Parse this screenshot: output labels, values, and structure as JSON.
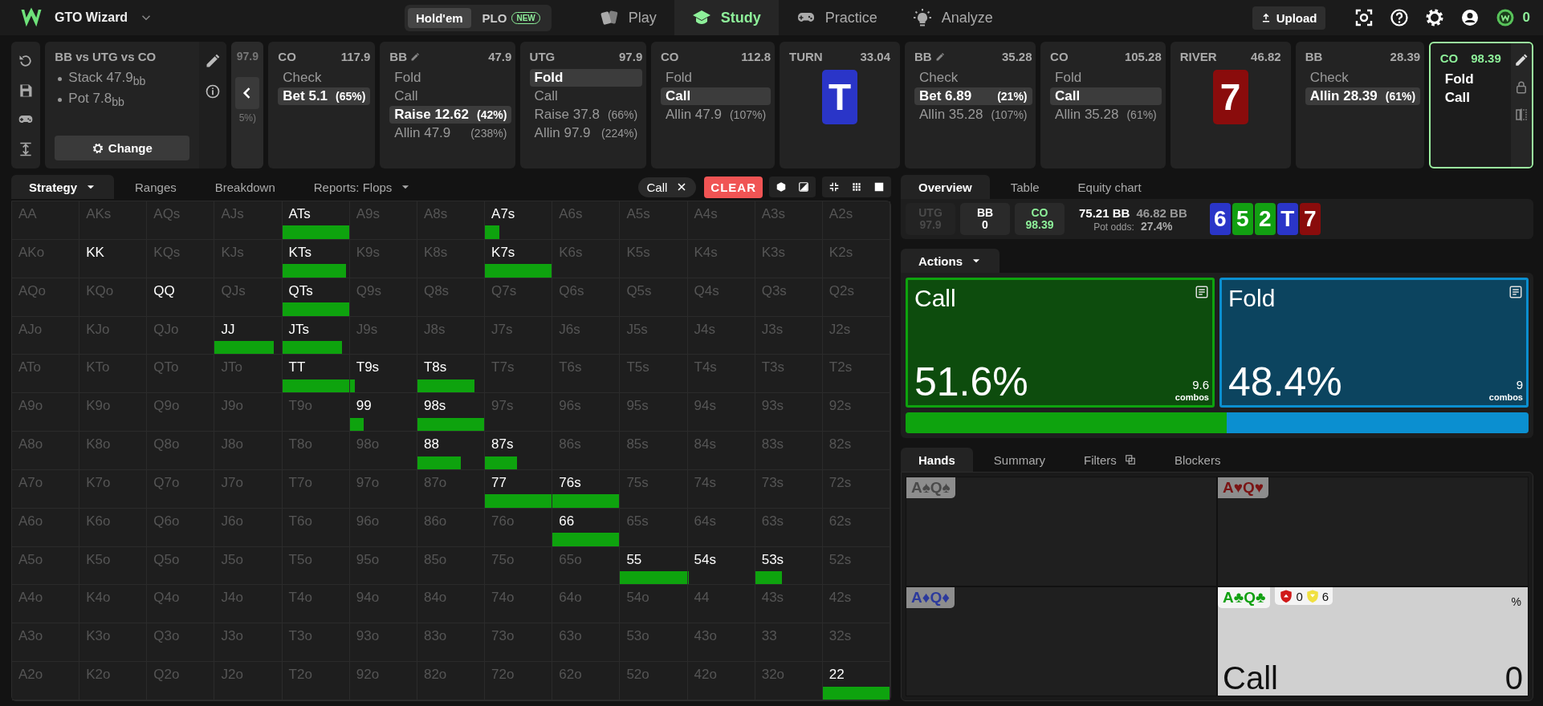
{
  "nav": {
    "brand": "GTO Wizard",
    "games": [
      {
        "label": "Hold'em",
        "selected": true
      },
      {
        "label": "PLO",
        "selected": false,
        "badge": "NEW"
      }
    ],
    "links": [
      {
        "label": "Play",
        "selected": false
      },
      {
        "label": "Study",
        "selected": true
      },
      {
        "label": "Practice",
        "selected": false
      },
      {
        "label": "Analyze",
        "selected": false
      }
    ],
    "upload": "Upload",
    "coins": "0"
  },
  "spot": {
    "title": "BB vs UTG vs CO",
    "stats": [
      "Stack 47.9$_{bb}$",
      "Pot 7.8$_{bb}$"
    ],
    "button": "Change"
  },
  "partial": {
    "stack": "97.9",
    "pct": "5%)"
  },
  "cards": [
    {
      "kind": "action",
      "player": "CO",
      "stack": "117.9",
      "edited": false,
      "current": false,
      "options": [
        {
          "label": "Check",
          "selected": false
        },
        {
          "label": "Bet 5.1",
          "pct": "(65%)",
          "selected": true
        }
      ]
    },
    {
      "kind": "action",
      "player": "BB",
      "stack": "47.9",
      "edited": true,
      "current": false,
      "options": [
        {
          "label": "Fold",
          "selected": false
        },
        {
          "label": "Call",
          "selected": false
        },
        {
          "label": "Raise 12.62",
          "pct": "(42%)",
          "selected": true
        },
        {
          "label": "Allin 47.9",
          "pct": "(238%)",
          "selected": false
        }
      ]
    },
    {
      "kind": "action",
      "player": "UTG",
      "stack": "97.9",
      "edited": false,
      "current": false,
      "options": [
        {
          "label": "Fold",
          "selected": true
        },
        {
          "label": "Call",
          "selected": false
        },
        {
          "label": "Raise 37.8",
          "pct": "(66%)",
          "selected": false
        },
        {
          "label": "Allin 97.9",
          "pct": "(224%)",
          "selected": false
        }
      ]
    },
    {
      "kind": "action",
      "player": "CO",
      "stack": "112.8",
      "edited": false,
      "current": false,
      "options": [
        {
          "label": "Fold",
          "selected": false
        },
        {
          "label": "Call",
          "selected": true
        },
        {
          "label": "Allin 47.9",
          "pct": "(107%)",
          "selected": false
        }
      ]
    },
    {
      "kind": "street",
      "street": "TURN",
      "pot": "33.04",
      "card": {
        "rank": "T",
        "color": "#2a35c8"
      }
    },
    {
      "kind": "action",
      "player": "BB",
      "stack": "35.28",
      "edited": true,
      "current": false,
      "options": [
        {
          "label": "Check",
          "selected": false
        },
        {
          "label": "Bet 6.89",
          "pct": "(21%)",
          "selected": true
        },
        {
          "label": "Allin 35.28",
          "pct": "(107%)",
          "selected": false
        }
      ]
    },
    {
      "kind": "action",
      "player": "CO",
      "stack": "105.28",
      "edited": false,
      "current": false,
      "options": [
        {
          "label": "Fold",
          "selected": false
        },
        {
          "label": "Call",
          "selected": true
        },
        {
          "label": "Allin 35.28",
          "pct": "(61%)",
          "selected": false
        }
      ]
    },
    {
      "kind": "street",
      "street": "RIVER",
      "pot": "46.82",
      "card": {
        "rank": "7",
        "color": "#8a0c0c"
      }
    },
    {
      "kind": "action",
      "player": "BB",
      "stack": "28.39",
      "edited": false,
      "current": false,
      "options": [
        {
          "label": "Check",
          "selected": false
        },
        {
          "label": "Allin 28.39",
          "pct": "(61%)",
          "selected": true
        }
      ]
    },
    {
      "kind": "action",
      "player": "CO",
      "stack": "98.39",
      "edited": false,
      "current": true,
      "options": [
        {
          "label": "Fold",
          "selected": false
        },
        {
          "label": "Call",
          "selected": false
        }
      ]
    }
  ],
  "strategy": {
    "tabs": [
      {
        "label": "Strategy",
        "selected": true,
        "dropdown": true
      },
      {
        "label": "Ranges",
        "selected": false,
        "dropdown": false
      },
      {
        "label": "Breakdown",
        "selected": false,
        "dropdown": false
      },
      {
        "label": "Reports: Flops",
        "selected": false,
        "dropdown": true
      }
    ],
    "filter": "Call",
    "clear": "CLEAR",
    "matrix": [
      [
        {
          "hand": "AA",
          "in_range": false
        },
        {
          "hand": "AKs",
          "in_range": false
        },
        {
          "hand": "AQs",
          "in_range": false
        },
        {
          "hand": "AJs",
          "in_range": false
        },
        {
          "hand": "ATs",
          "in_range": true,
          "call": {
            "level": 1
          }
        },
        {
          "hand": "A9s",
          "in_range": false
        },
        {
          "hand": "A8s",
          "in_range": false
        },
        {
          "hand": "A7s",
          "in_range": true,
          "call": {
            "level": 0.21
          }
        },
        {
          "hand": "A6s",
          "in_range": false
        },
        {
          "hand": "A5s",
          "in_range": false
        },
        {
          "hand": "A4s",
          "in_range": false
        },
        {
          "hand": "A3s",
          "in_range": false
        },
        {
          "hand": "A2s",
          "in_range": false
        }
      ],
      [
        {
          "hand": "AKo",
          "in_range": false
        },
        {
          "hand": "KK",
          "in_range": true
        },
        {
          "hand": "KQs",
          "in_range": false
        },
        {
          "hand": "KJs",
          "in_range": false
        },
        {
          "hand": "KTs",
          "in_range": true,
          "call": {
            "level": 0.95
          }
        },
        {
          "hand": "K9s",
          "in_range": false
        },
        {
          "hand": "K8s",
          "in_range": false
        },
        {
          "hand": "K7s",
          "in_range": true,
          "call": {
            "level": 1
          }
        },
        {
          "hand": "K6s",
          "in_range": false
        },
        {
          "hand": "K5s",
          "in_range": false
        },
        {
          "hand": "K4s",
          "in_range": false
        },
        {
          "hand": "K3s",
          "in_range": false
        },
        {
          "hand": "K2s",
          "in_range": false
        }
      ],
      [
        {
          "hand": "AQo",
          "in_range": false
        },
        {
          "hand": "KQo",
          "in_range": false
        },
        {
          "hand": "QQ",
          "in_range": true
        },
        {
          "hand": "QJs",
          "in_range": false
        },
        {
          "hand": "QTs",
          "in_range": true,
          "call": {
            "level": 1
          }
        },
        {
          "hand": "Q9s",
          "in_range": false
        },
        {
          "hand": "Q8s",
          "in_range": false
        },
        {
          "hand": "Q7s",
          "in_range": false
        },
        {
          "hand": "Q6s",
          "in_range": false
        },
        {
          "hand": "Q5s",
          "in_range": false
        },
        {
          "hand": "Q4s",
          "in_range": false
        },
        {
          "hand": "Q3s",
          "in_range": false
        },
        {
          "hand": "Q2s",
          "in_range": false
        }
      ],
      [
        {
          "hand": "AJo",
          "in_range": false
        },
        {
          "hand": "KJo",
          "in_range": false
        },
        {
          "hand": "QJo",
          "in_range": false
        },
        {
          "hand": "JJ",
          "in_range": true,
          "call": {
            "level": 0.88
          }
        },
        {
          "hand": "JTs",
          "in_range": true,
          "call": {
            "level": 0.9
          }
        },
        {
          "hand": "J9s",
          "in_range": false
        },
        {
          "hand": "J8s",
          "in_range": false
        },
        {
          "hand": "J7s",
          "in_range": false
        },
        {
          "hand": "J6s",
          "in_range": false
        },
        {
          "hand": "J5s",
          "in_range": false
        },
        {
          "hand": "J4s",
          "in_range": false
        },
        {
          "hand": "J3s",
          "in_range": false
        },
        {
          "hand": "J2s",
          "in_range": false
        }
      ],
      [
        {
          "hand": "ATo",
          "in_range": false
        },
        {
          "hand": "KTo",
          "in_range": false
        },
        {
          "hand": "QTo",
          "in_range": false
        },
        {
          "hand": "JTo",
          "in_range": false
        },
        {
          "hand": "TT",
          "in_range": true,
          "call": {
            "level": 1
          }
        },
        {
          "hand": "T9s",
          "in_range": true,
          "call": {
            "level": 0.07
          }
        },
        {
          "hand": "T8s",
          "in_range": true,
          "call": {
            "level": 0.85
          }
        },
        {
          "hand": "T7s",
          "in_range": false
        },
        {
          "hand": "T6s",
          "in_range": false
        },
        {
          "hand": "T5s",
          "in_range": false
        },
        {
          "hand": "T4s",
          "in_range": false
        },
        {
          "hand": "T3s",
          "in_range": false
        },
        {
          "hand": "T2s",
          "in_range": false
        }
      ],
      [
        {
          "hand": "A9o",
          "in_range": false
        },
        {
          "hand": "K9o",
          "in_range": false
        },
        {
          "hand": "Q9o",
          "in_range": false
        },
        {
          "hand": "J9o",
          "in_range": false
        },
        {
          "hand": "T9o",
          "in_range": false
        },
        {
          "hand": "99",
          "in_range": true,
          "call": {
            "level": 0.21
          }
        },
        {
          "hand": "98s",
          "in_range": true,
          "call": {
            "level": 1
          }
        },
        {
          "hand": "97s",
          "in_range": false
        },
        {
          "hand": "96s",
          "in_range": false
        },
        {
          "hand": "95s",
          "in_range": false
        },
        {
          "hand": "94s",
          "in_range": false
        },
        {
          "hand": "93s",
          "in_range": false
        },
        {
          "hand": "92s",
          "in_range": false
        }
      ],
      [
        {
          "hand": "A8o",
          "in_range": false
        },
        {
          "hand": "K8o",
          "in_range": false
        },
        {
          "hand": "Q8o",
          "in_range": false
        },
        {
          "hand": "J8o",
          "in_range": false
        },
        {
          "hand": "T8o",
          "in_range": false
        },
        {
          "hand": "98o",
          "in_range": false
        },
        {
          "hand": "88",
          "in_range": true,
          "call": {
            "level": 0.65
          }
        },
        {
          "hand": "87s",
          "in_range": true,
          "call": {
            "level": 0.48
          }
        },
        {
          "hand": "86s",
          "in_range": false
        },
        {
          "hand": "85s",
          "in_range": false
        },
        {
          "hand": "84s",
          "in_range": false
        },
        {
          "hand": "83s",
          "in_range": false
        },
        {
          "hand": "82s",
          "in_range": false
        }
      ],
      [
        {
          "hand": "A7o",
          "in_range": false
        },
        {
          "hand": "K7o",
          "in_range": false
        },
        {
          "hand": "Q7o",
          "in_range": false
        },
        {
          "hand": "J7o",
          "in_range": false
        },
        {
          "hand": "T7o",
          "in_range": false
        },
        {
          "hand": "97o",
          "in_range": false
        },
        {
          "hand": "87o",
          "in_range": false
        },
        {
          "hand": "77",
          "in_range": true,
          "call": {
            "level": 1
          }
        },
        {
          "hand": "76s",
          "in_range": true,
          "call": {
            "level": 1
          }
        },
        {
          "hand": "75s",
          "in_range": false
        },
        {
          "hand": "74s",
          "in_range": false
        },
        {
          "hand": "73s",
          "in_range": false
        },
        {
          "hand": "72s",
          "in_range": false
        }
      ],
      [
        {
          "hand": "A6o",
          "in_range": false
        },
        {
          "hand": "K6o",
          "in_range": false
        },
        {
          "hand": "Q6o",
          "in_range": false
        },
        {
          "hand": "J6o",
          "in_range": false
        },
        {
          "hand": "T6o",
          "in_range": false
        },
        {
          "hand": "96o",
          "in_range": false
        },
        {
          "hand": "86o",
          "in_range": false
        },
        {
          "hand": "76o",
          "in_range": false
        },
        {
          "hand": "66",
          "in_range": true,
          "call": {
            "level": 1
          }
        },
        {
          "hand": "65s",
          "in_range": false
        },
        {
          "hand": "64s",
          "in_range": false
        },
        {
          "hand": "63s",
          "in_range": false
        },
        {
          "hand": "62s",
          "in_range": false
        }
      ],
      [
        {
          "hand": "A5o",
          "in_range": false
        },
        {
          "hand": "K5o",
          "in_range": false
        },
        {
          "hand": "Q5o",
          "in_range": false
        },
        {
          "hand": "J5o",
          "in_range": false
        },
        {
          "hand": "T5o",
          "in_range": false
        },
        {
          "hand": "95o",
          "in_range": false
        },
        {
          "hand": "85o",
          "in_range": false
        },
        {
          "hand": "75o",
          "in_range": false
        },
        {
          "hand": "65o",
          "in_range": false
        },
        {
          "hand": "55",
          "in_range": true,
          "call": {
            "level": 1
          }
        },
        {
          "hand": "54s",
          "in_range": true,
          "call": {
            "level": 0.02
          }
        },
        {
          "hand": "53s",
          "in_range": true,
          "call": {
            "level": 0.4
          }
        },
        {
          "hand": "52s",
          "in_range": false
        }
      ],
      [
        {
          "hand": "A4o",
          "in_range": false
        },
        {
          "hand": "K4o",
          "in_range": false
        },
        {
          "hand": "Q4o",
          "in_range": false
        },
        {
          "hand": "J4o",
          "in_range": false
        },
        {
          "hand": "T4o",
          "in_range": false
        },
        {
          "hand": "94o",
          "in_range": false
        },
        {
          "hand": "84o",
          "in_range": false
        },
        {
          "hand": "74o",
          "in_range": false
        },
        {
          "hand": "64o",
          "in_range": false
        },
        {
          "hand": "54o",
          "in_range": false
        },
        {
          "hand": "44",
          "in_range": false
        },
        {
          "hand": "43s",
          "in_range": false
        },
        {
          "hand": "42s",
          "in_range": false
        }
      ],
      [
        {
          "hand": "A3o",
          "in_range": false
        },
        {
          "hand": "K3o",
          "in_range": false
        },
        {
          "hand": "Q3o",
          "in_range": false
        },
        {
          "hand": "J3o",
          "in_range": false
        },
        {
          "hand": "T3o",
          "in_range": false
        },
        {
          "hand": "93o",
          "in_range": false
        },
        {
          "hand": "83o",
          "in_range": false
        },
        {
          "hand": "73o",
          "in_range": false
        },
        {
          "hand": "63o",
          "in_range": false
        },
        {
          "hand": "53o",
          "in_range": false
        },
        {
          "hand": "43o",
          "in_range": false
        },
        {
          "hand": "33",
          "in_range": false
        },
        {
          "hand": "32s",
          "in_range": false
        }
      ],
      [
        {
          "hand": "A2o",
          "in_range": false
        },
        {
          "hand": "K2o",
          "in_range": false
        },
        {
          "hand": "Q2o",
          "in_range": false
        },
        {
          "hand": "J2o",
          "in_range": false
        },
        {
          "hand": "T2o",
          "in_range": false
        },
        {
          "hand": "92o",
          "in_range": false
        },
        {
          "hand": "82o",
          "in_range": false
        },
        {
          "hand": "72o",
          "in_range": false
        },
        {
          "hand": "62o",
          "in_range": false
        },
        {
          "hand": "52o",
          "in_range": false
        },
        {
          "hand": "42o",
          "in_range": false
        },
        {
          "hand": "32o",
          "in_range": false
        },
        {
          "hand": "22",
          "in_range": true,
          "call": {
            "level": 1
          }
        }
      ]
    ]
  },
  "overview": {
    "tabs": [
      {
        "label": "Overview",
        "selected": true
      },
      {
        "label": "Table",
        "selected": false
      },
      {
        "label": "Equity chart",
        "selected": false
      }
    ],
    "players": [
      {
        "name": "UTG",
        "stack": "97.9",
        "folded": true,
        "acting": false
      },
      {
        "name": "BB",
        "stack": "0",
        "folded": false,
        "acting": false
      },
      {
        "name": "CO",
        "stack": "98.39",
        "folded": false,
        "acting": true
      }
    ],
    "pot": "75.21 BB",
    "amount": "46.82 BB",
    "pot_odds_label": "Pot odds:",
    "pot_odds": "27.4%",
    "board": [
      {
        "rank": "6",
        "color": "#2a35c8"
      },
      {
        "rank": "5",
        "color": "#12a012"
      },
      {
        "rank": "2",
        "color": "#12a012"
      },
      {
        "rank": "T",
        "color": "#2a35c8"
      },
      {
        "rank": "7",
        "color": "#8a0c0c"
      }
    ],
    "actions_tab": "Actions",
    "actions": [
      {
        "name": "Call",
        "percent": "51.6%",
        "combos": "9.6",
        "combos_label": "combos",
        "color": "#0ea30e",
        "level": 0.516
      },
      {
        "name": "Fold",
        "percent": "48.4%",
        "combos": "9",
        "combos_label": "combos",
        "color": "#0b8fd0",
        "level": 0.484
      }
    ]
  },
  "hands": {
    "tabs": [
      {
        "label": "Hands",
        "selected": true
      },
      {
        "label": "Summary",
        "selected": false
      },
      {
        "label": "Filters",
        "selected": false
      },
      {
        "label": "Blockers",
        "selected": false
      }
    ],
    "combos": [
      {
        "combo": "A♠Q♠",
        "kind": "spades",
        "selected": false
      },
      {
        "combo": "A♥Q♥",
        "kind": "hearts",
        "selected": false
      },
      {
        "combo": "A♦Q♦",
        "kind": "diamonds",
        "selected": false
      },
      {
        "combo": "A♣Q♣",
        "kind": "clubs",
        "selected": true,
        "detail": {
          "badges": [
            {
              "kind": "up",
              "value": "0"
            },
            {
              "kind": "down",
              "value": "6"
            }
          ],
          "unit": "%",
          "action": "Call",
          "value": "0"
        }
      }
    ]
  }
}
